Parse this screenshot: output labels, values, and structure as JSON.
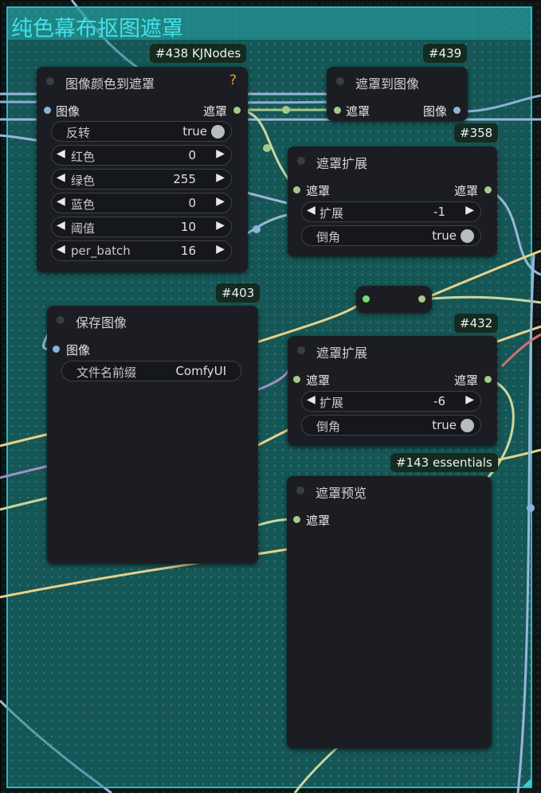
{
  "group": {
    "title": "纯色幕布抠图遮罩"
  },
  "nodes": {
    "n438": {
      "badge": "#438 KJNodes",
      "title": "图像颜色到遮罩",
      "help": "?",
      "input": "图像",
      "output": "遮罩",
      "widgets": {
        "invert": {
          "label": "反转",
          "value": "true"
        },
        "red": {
          "label": "红色",
          "value": "0"
        },
        "green": {
          "label": "绿色",
          "value": "255"
        },
        "blue": {
          "label": "蓝色",
          "value": "0"
        },
        "threshold": {
          "label": "阈值",
          "value": "10"
        },
        "per_batch": {
          "label": "per_batch",
          "value": "16"
        }
      }
    },
    "n439": {
      "badge": "#439",
      "title": "遮罩到图像",
      "input": "遮罩",
      "output": "图像"
    },
    "n358": {
      "badge": "#358",
      "title": "遮罩扩展",
      "input": "遮罩",
      "output": "遮罩",
      "widgets": {
        "expand": {
          "label": "扩展",
          "value": "-1"
        },
        "chamfer": {
          "label": "倒角",
          "value": "true"
        }
      }
    },
    "n403": {
      "badge": "#403",
      "title": "保存图像",
      "input": "图像",
      "widgets": {
        "prefix": {
          "label": "文件名前缀",
          "value": "ComfyUI"
        }
      }
    },
    "n432": {
      "badge": "#432",
      "title": "遮罩扩展",
      "input": "遮罩",
      "output": "遮罩",
      "widgets": {
        "expand": {
          "label": "扩展",
          "value": "-6"
        },
        "chamfer": {
          "label": "倒角",
          "value": "true"
        }
      }
    },
    "n143": {
      "badge": "#143 essentials",
      "title": "遮罩预览",
      "input": "遮罩"
    }
  },
  "icons": {
    "left": "◀",
    "right": "▶"
  },
  "colors": {
    "image_slot": "#8ab4dc",
    "mask_slot": "#a5c98a",
    "group_border": "#2bb8c0",
    "group_title": "#43e0e8",
    "help": "#f0a020"
  }
}
